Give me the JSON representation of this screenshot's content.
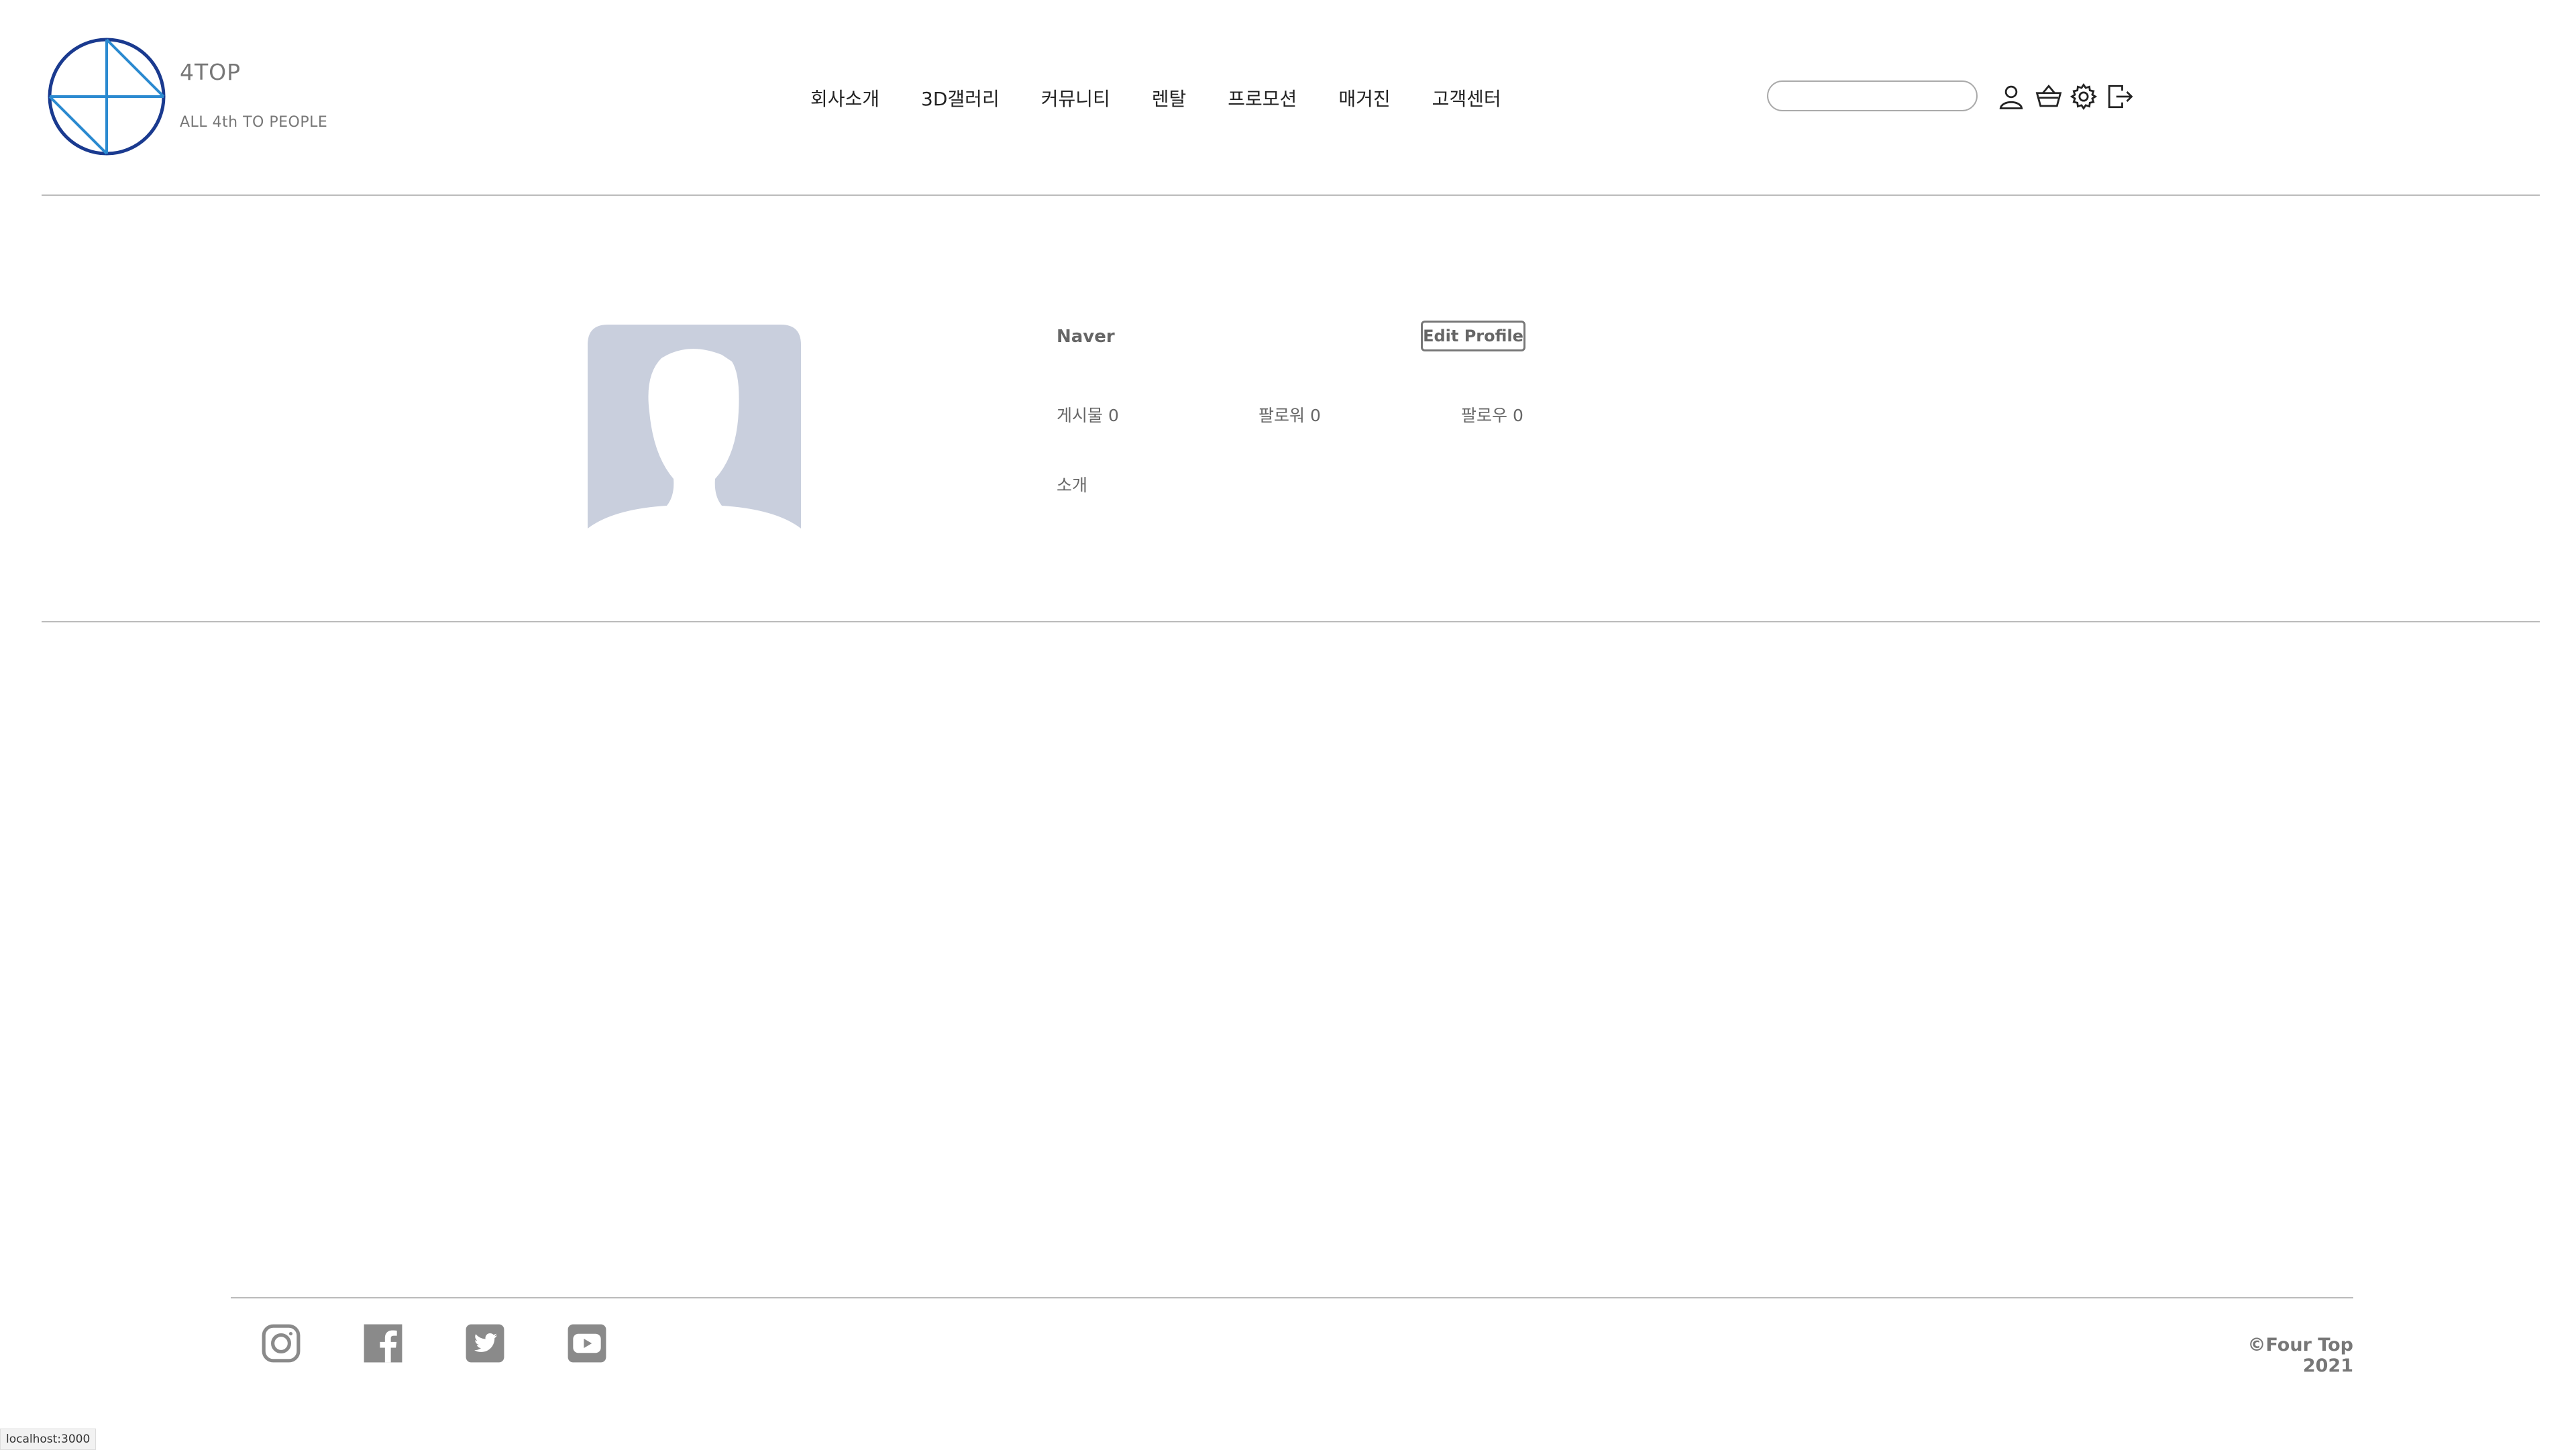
{
  "brand": {
    "name": "4TOP",
    "tagline": "ALL 4th TO PEOPLE",
    "colors": {
      "ring": "#1a3a8f",
      "cross": "#2b8ad0"
    }
  },
  "nav": {
    "items": [
      {
        "label": "회사소개"
      },
      {
        "label": "3D갤러리"
      },
      {
        "label": "커뮤니티"
      },
      {
        "label": "렌탈"
      },
      {
        "label": "프로모션"
      },
      {
        "label": "매거진"
      },
      {
        "label": "고객센터"
      }
    ]
  },
  "search": {
    "value": "",
    "placeholder": ""
  },
  "header_icons": [
    "user-icon",
    "basket-icon",
    "gear-icon",
    "logout-icon"
  ],
  "profile": {
    "username": "Naver",
    "edit_label": "Edit Profile",
    "stats": {
      "posts": "게시물 0",
      "followers": "팔로워 0",
      "following": "팔로우 0"
    },
    "intro_label": "소개",
    "avatar_color": "#c9cfdd"
  },
  "footer": {
    "social": [
      "instagram-icon",
      "facebook-icon",
      "twitter-icon",
      "youtube-icon"
    ],
    "copyright": "©Four Top 2021",
    "icon_color": "#8a8a8a"
  },
  "status_bar": {
    "url": "localhost:3000"
  }
}
